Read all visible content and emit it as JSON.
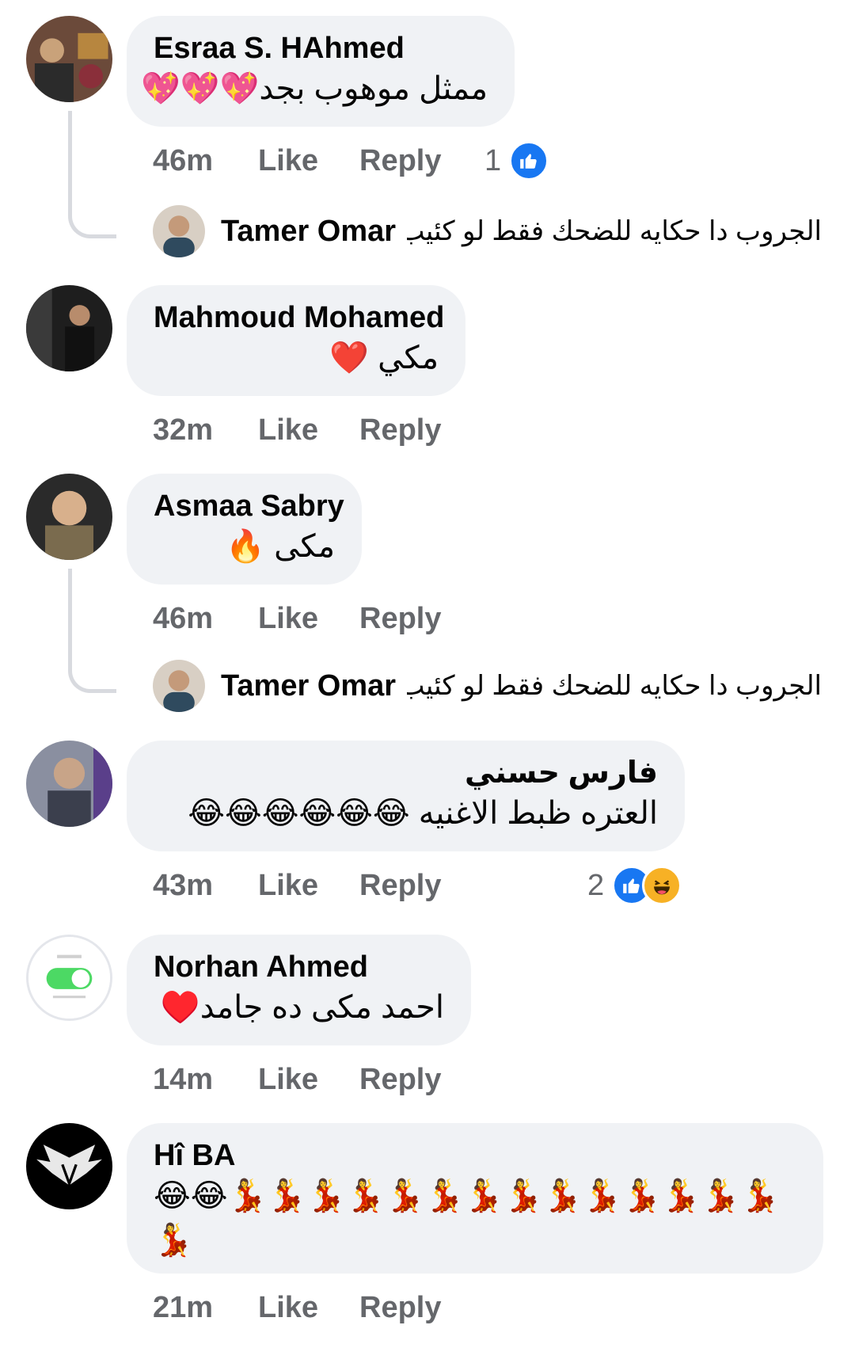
{
  "comments": [
    {
      "name": "Esraa S. HAhmed",
      "text": "ممثل موهوب بجد💖💖💖",
      "time": "46m",
      "like": "Like",
      "reply": "Reply",
      "reaction_count": "1",
      "reactions": [
        "like-icon"
      ],
      "replies": [
        {
          "name": "Tamer Omar",
          "text": "الجروب دا حكايه للضحك فقط لو كئيب ..."
        }
      ]
    },
    {
      "name": "Mahmoud Mohamed",
      "text": "مكي ❤️",
      "time": "32m",
      "like": "Like",
      "reply": "Reply"
    },
    {
      "name": "Asmaa Sabry",
      "text": "مكى 🔥",
      "time": "46m",
      "like": "Like",
      "reply": "Reply",
      "replies": [
        {
          "name": "Tamer Omar",
          "text": "الجروب دا حكايه للضحك فقط لو كئيب ..."
        }
      ]
    },
    {
      "name": "فارس حسني",
      "text": "العتره ظبط الاغنيه 😂😂😂😂😂😂",
      "time": "43m",
      "like": "Like",
      "reply": "Reply",
      "reaction_count": "2",
      "reactions": [
        "like-icon",
        "haha-icon"
      ]
    },
    {
      "name": "Norhan Ahmed",
      "text": "احمد مكى ده جامد♥️",
      "time": "14m",
      "like": "Like",
      "reply": "Reply"
    },
    {
      "name": "Hî BA",
      "text": "😂😂💃💃💃💃💃💃💃💃💃💃💃💃💃💃💃",
      "time": "21m",
      "like": "Like",
      "reply": "Reply"
    }
  ],
  "colors": {
    "bubble": "#f0f2f5",
    "meta_text": "#65676b",
    "like_blue": "#1877f2",
    "haha_yellow": "#f7b125"
  }
}
